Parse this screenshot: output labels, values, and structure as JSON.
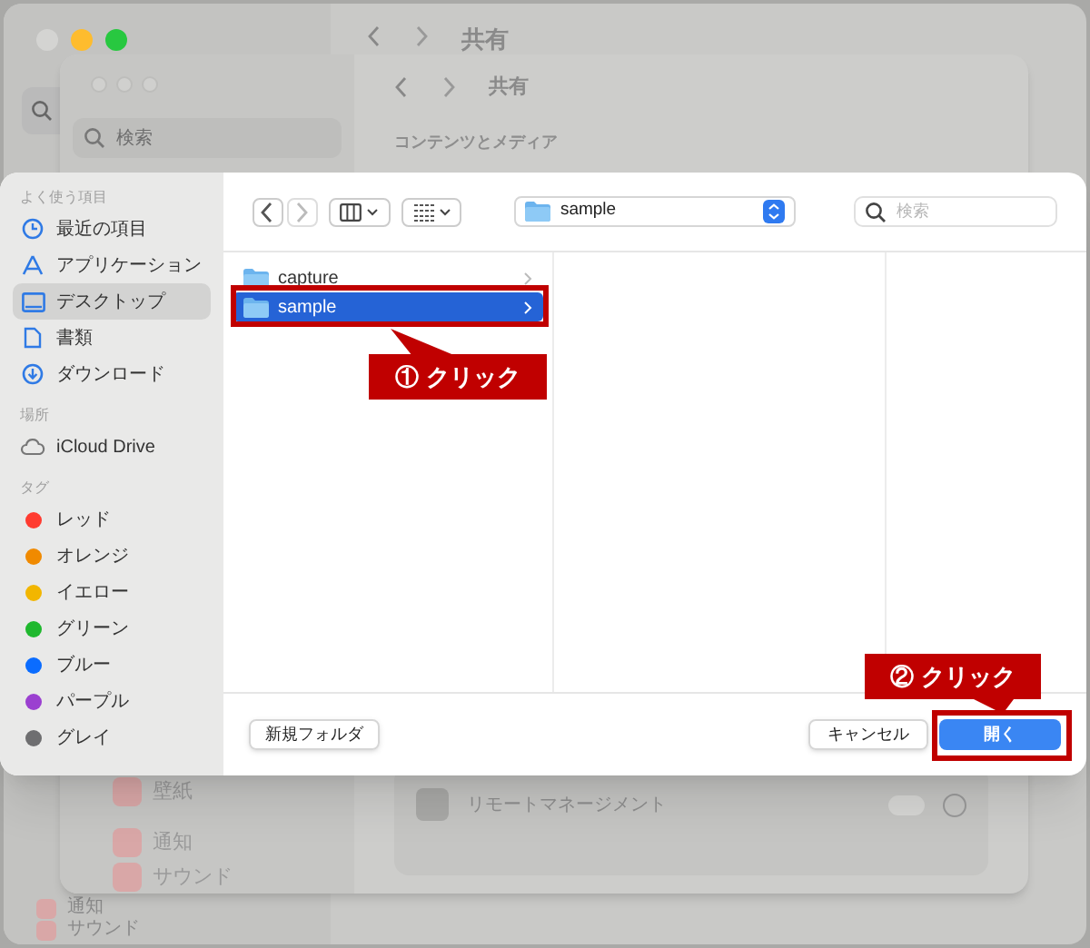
{
  "back_window": {
    "title": "共有",
    "lights": [
      {
        "color": "#d4d4d2"
      },
      {
        "color": "#febc2e"
      },
      {
        "color": "#28c840"
      }
    ],
    "sidebar_items": [
      "通知",
      "サウンド"
    ]
  },
  "inner_window": {
    "title": "共有",
    "search": {
      "placeholder": "検索"
    },
    "section_title": "コンテンツとメディア",
    "sidebar_items": [
      "壁紙",
      "通知",
      "サウンド"
    ],
    "rows": [
      {
        "label": "リモートマネージメント",
        "on": false
      }
    ]
  },
  "dialog": {
    "sidebar": [
      {
        "heading": "よく使う項目",
        "items": [
          {
            "label": "最近の項目",
            "kind": "clock",
            "selected": false
          },
          {
            "label": "アプリケーション",
            "kind": "apps",
            "selected": false
          },
          {
            "label": "デスクトップ",
            "kind": "desktop",
            "selected": true
          },
          {
            "label": "書類",
            "kind": "doc",
            "selected": false
          },
          {
            "label": "ダウンロード",
            "kind": "download",
            "selected": false
          }
        ]
      },
      {
        "heading": "場所",
        "items": [
          {
            "label": "iCloud Drive",
            "kind": "cloud",
            "selected": false
          }
        ]
      },
      {
        "heading": "タグ",
        "items": [
          {
            "label": "レッド",
            "kind": "tag",
            "color": "#ff3b30",
            "selected": false
          },
          {
            "label": "オレンジ",
            "kind": "tag",
            "color": "#f08a00",
            "selected": false
          },
          {
            "label": "イエロー",
            "kind": "tag",
            "color": "#f2b600",
            "selected": false
          },
          {
            "label": "グリーン",
            "kind": "tag",
            "color": "#1fb82e",
            "selected": false
          },
          {
            "label": "ブルー",
            "kind": "tag",
            "color": "#0a6cff",
            "selected": false
          },
          {
            "label": "パープル",
            "kind": "tag",
            "color": "#9b40d0",
            "selected": false
          },
          {
            "label": "グレイ",
            "kind": "tag",
            "color": "#6e6e70",
            "selected": false
          }
        ]
      }
    ],
    "location": "sample",
    "search": {
      "placeholder": "検索"
    },
    "column_1": [
      {
        "name": "capture",
        "selected": false
      },
      {
        "name": "sample",
        "selected": true
      }
    ],
    "new_folder_button": "新規フォルダ",
    "cancel_button": "キャンセル",
    "open_button": "開く"
  },
  "annotations": [
    {
      "label": "① クリック"
    },
    {
      "label": "② クリック"
    }
  ]
}
